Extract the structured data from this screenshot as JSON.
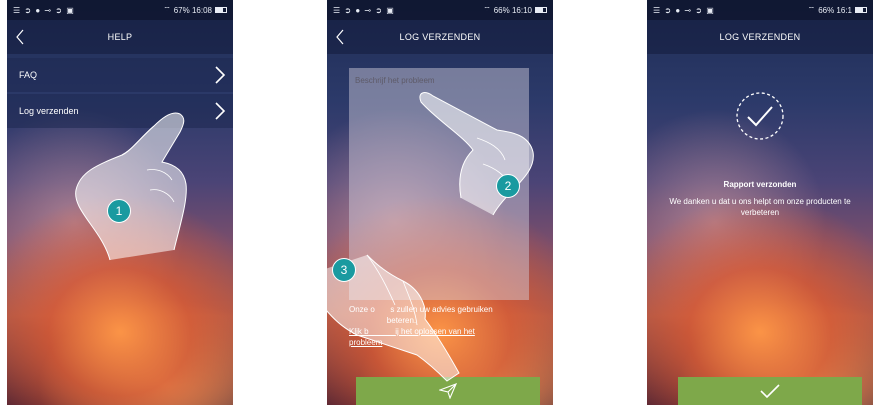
{
  "status": {
    "left_icons": "☰ ➲ ● ⊸ ➲ ▣",
    "p1": "67% 16:08",
    "p2": "66% 16:10",
    "p3": "66% 16:1"
  },
  "screen1": {
    "title": "HELP",
    "items": [
      {
        "label": "FAQ"
      },
      {
        "label": "Log verzenden"
      }
    ],
    "step": "1"
  },
  "screen2": {
    "title": "LOG VERZENDEN",
    "placeholder": "Beschrijf het probleem",
    "info_line1": "Onze o",
    "info_line1b": "s zullen uw advies gebruiken",
    "info_line2": "beteren.",
    "info_link1": "Klik b",
    "info_link1b": "ij het oplossen van het",
    "info_link2": "probleem",
    "step_textarea": "2",
    "step_send": "3"
  },
  "screen3": {
    "title": "LOG VERZENDEN",
    "confirm_title": "Rapport verzonden",
    "confirm_msg": "We danken u dat u ons helpt om onze producten te verbeteren"
  },
  "colors": {
    "accent_green": "#7ea84a",
    "step_teal": "#1a9aa0"
  },
  "icons": {
    "back": "chevron-left-icon",
    "forward": "chevron-right-icon",
    "send": "send-icon",
    "check": "check-icon"
  }
}
